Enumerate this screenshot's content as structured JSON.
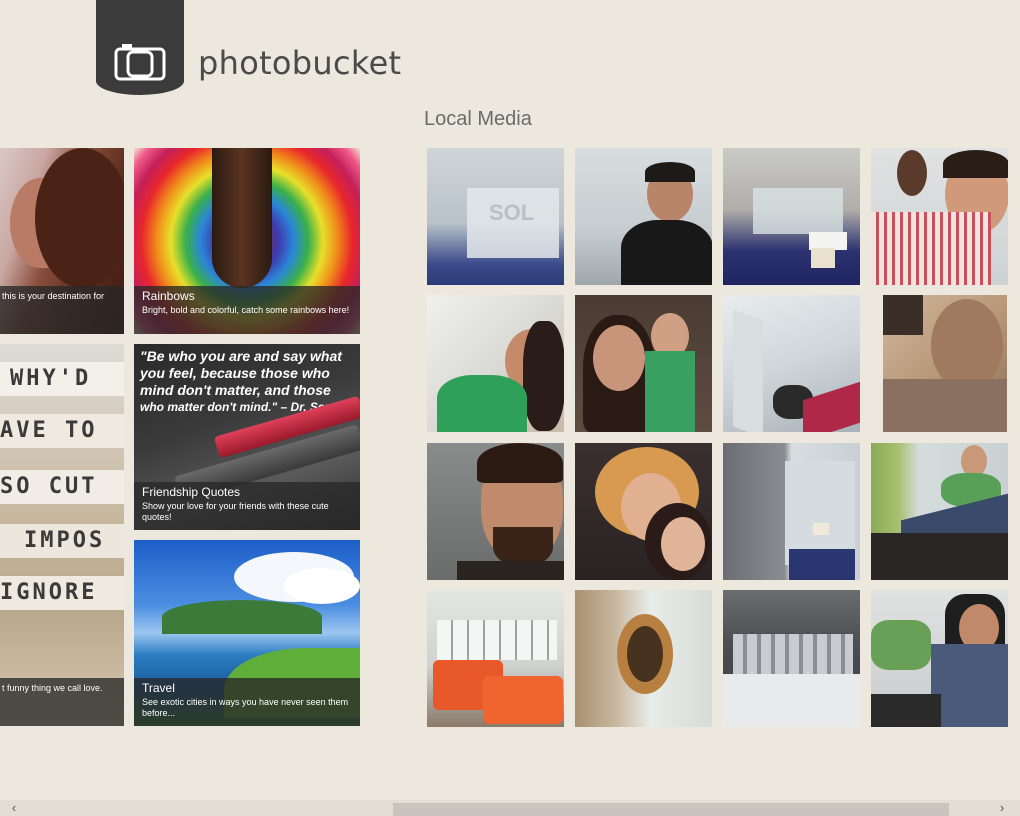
{
  "app": {
    "name": "photobucket"
  },
  "section": {
    "title": "Local Media"
  },
  "featured": [
    {
      "title": "",
      "description": "this is your destination for"
    },
    {
      "title": "Rainbows",
      "description": "Bright, bold and colorful, catch some rainbows here!"
    },
    {
      "title": "",
      "description": "t funny thing we call love."
    },
    {
      "title": "Friendship Quotes",
      "description": "Show your love for your friends with these cute quotes!"
    },
    {
      "title": "Travel",
      "description": "See exotic cities in ways you have never seen them before..."
    }
  ],
  "tile_text": {
    "quote_lines": [
      "\"Be who you are and say what",
      "you feel, because those who",
      "mind don't matter, and those",
      "who matter don't mind.\" – Dr. Seuss"
    ],
    "word_strips": [
      "WHY'D",
      "AVE TO",
      "SO CUT",
      "IMPOS",
      "IGNORE"
    ],
    "office_sign": "SOL"
  },
  "scrollbar": {
    "left_arrow": "‹",
    "right_arrow": "›"
  },
  "icons": {
    "logo": "camera-icon"
  },
  "colors": {
    "background": "#ede8de",
    "logo_tab": "#3b3b3b",
    "caption_bg": "#282828"
  }
}
